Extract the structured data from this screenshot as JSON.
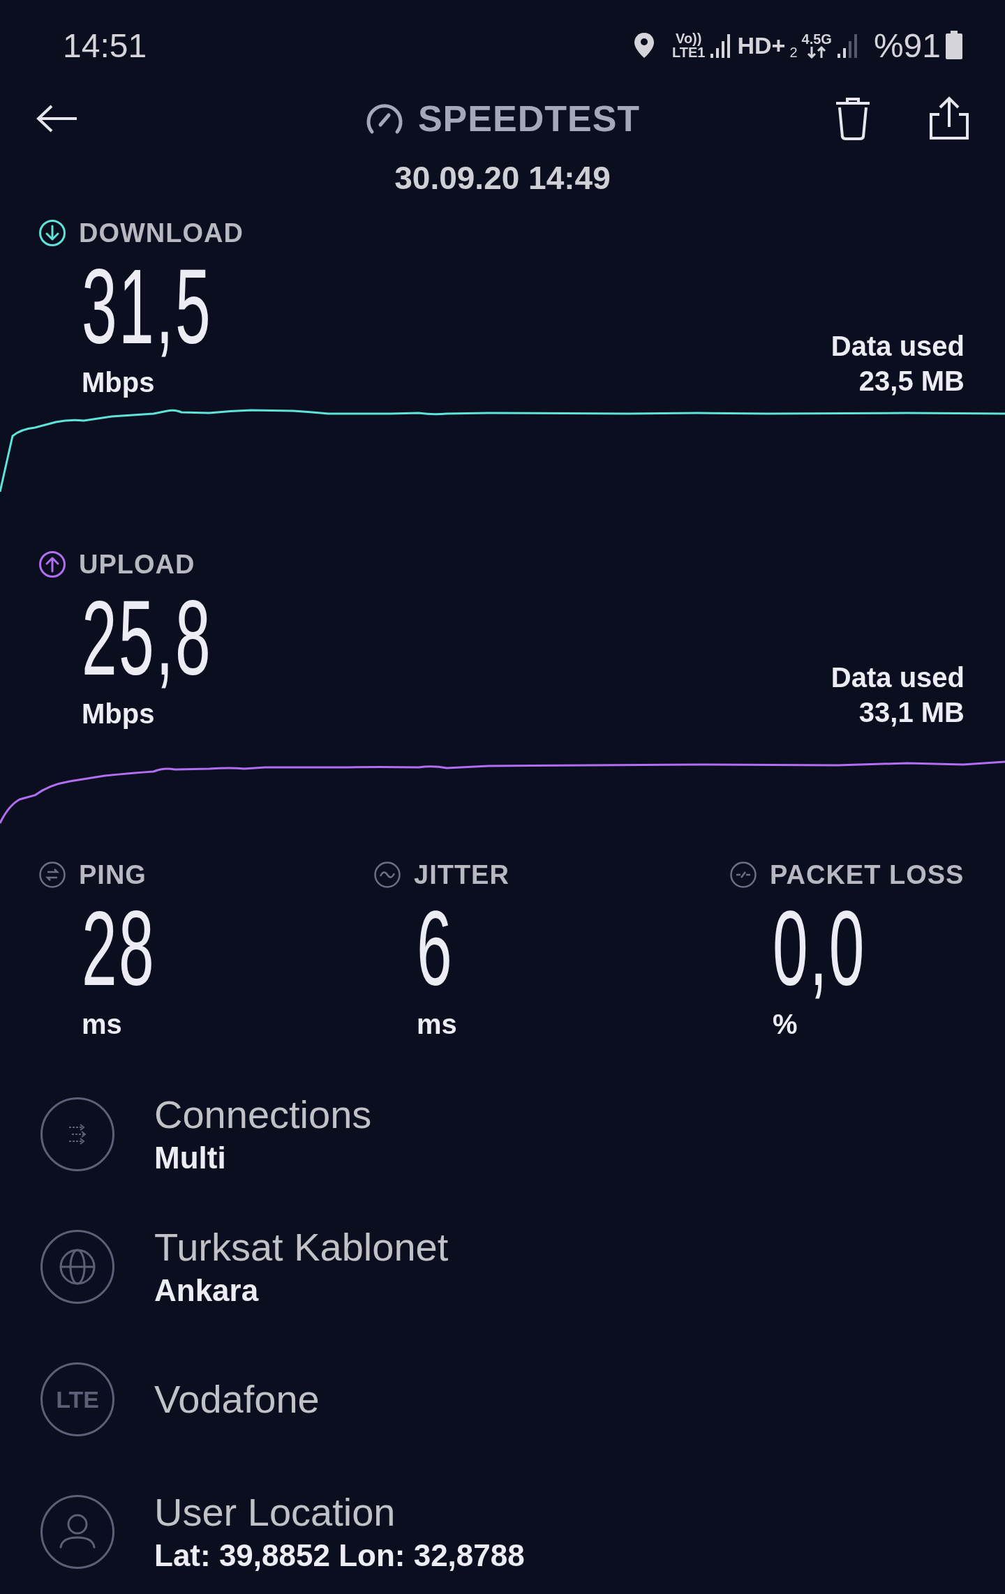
{
  "status_bar": {
    "time": "14:51",
    "volte_top": "Vo))",
    "volte_bottom": "LTE1",
    "hd": "HD+",
    "sim": "2",
    "network": "4.5G",
    "battery": "%91"
  },
  "header": {
    "title": "SPEEDTEST",
    "date": "30.09.20 14:49"
  },
  "results": [
    {
      "kind": "download",
      "label": "DOWNLOAD",
      "value": "31,5",
      "unit": "Mbps",
      "data_used_label": "Data used",
      "data_used_value": "23,5 MB",
      "color": "#5ee3d8"
    },
    {
      "kind": "upload",
      "label": "UPLOAD",
      "value": "25,8",
      "unit": "Mbps",
      "data_used_label": "Data used",
      "data_used_value": "33,1 MB",
      "color": "#b16ef2"
    }
  ],
  "metrics": [
    {
      "kind": "ping",
      "label": "PING",
      "value": "28",
      "unit": "ms"
    },
    {
      "kind": "jitter",
      "label": "JITTER",
      "value": "6",
      "unit": "ms"
    },
    {
      "kind": "packet_loss",
      "label": "PACKET LOSS",
      "value": "0,0",
      "unit": "%"
    }
  ],
  "details": [
    {
      "kind": "connections",
      "title": "Connections",
      "subtitle": "Multi"
    },
    {
      "kind": "server",
      "title": "Turksat Kablonet",
      "subtitle": "Ankara"
    },
    {
      "kind": "network",
      "badge": "LTE",
      "title": "Vodafone"
    },
    {
      "kind": "location",
      "title": "User Location",
      "subtitle": "Lat: 39,8852 Lon: 32,8788"
    }
  ]
}
